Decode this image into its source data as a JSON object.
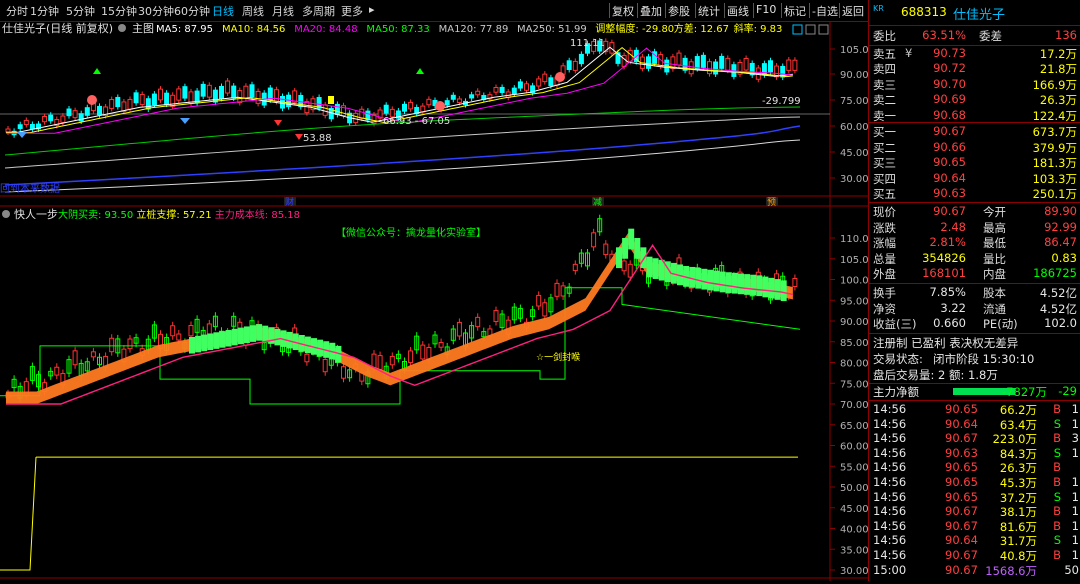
{
  "toolbar": {
    "periods": [
      "分时",
      "1分钟",
      "5分钟",
      "15分钟",
      "30分钟",
      "60分钟",
      "日线",
      "周线",
      "月线",
      "多周期",
      "更多"
    ],
    "active": "日线",
    "right_buttons": [
      "复权",
      "叠加",
      "参股",
      "统计",
      "画线",
      "F10",
      "标记",
      "-自选",
      "返回"
    ]
  },
  "main_chart": {
    "stock_title": "仕佳光子(日线 前复权)",
    "title_tag": "主图",
    "ma_items": [
      {
        "label": "MA5: 87.95",
        "color": "#ffffff"
      },
      {
        "label": "MA10: 84.56",
        "color": "#ffff00"
      },
      {
        "label": "MA20: 84.48",
        "color": "#ff00ff"
      },
      {
        "label": "MA50: 87.33",
        "color": "#00ff00"
      },
      {
        "label": "MA120: 77.89",
        "color": "#c8c8c8"
      },
      {
        "label": "MA250: 51.99",
        "color": "#c8c8c8"
      },
      {
        "label": "调整幅度: -29.80",
        "color": "#ffff00"
      },
      {
        "label": "方差: 12.67",
        "color": "#ffff00"
      },
      {
        "label": "斜率: 9.83",
        "color": "#ffff00"
      }
    ],
    "y_ticks": [
      "105.0",
      "90.00",
      "75.00",
      "60.00",
      "45.00",
      "30.00"
    ],
    "annotations": {
      "high": "111.11",
      "low": "53.88",
      "range": "66.93 - 67.05",
      "pct": "-29.799",
      "bottom_left": "回到本来数据"
    },
    "events": [
      "财",
      "减",
      "预"
    ]
  },
  "sub_chart": {
    "title": "快人一步",
    "legend": [
      {
        "label": "大阴买卖: 93.50",
        "color": "#00ff00"
      },
      {
        "label": "立桩支撑: 57.21",
        "color": "#ffff00"
      },
      {
        "label": "主力成本线: 85.18",
        "color": "#ff2080"
      }
    ],
    "banner": "【微信公众号：擒龙量化实验室】",
    "signal": "☆一剑封喉",
    "y_ticks": [
      "110.0",
      "105.0",
      "100.0",
      "95.00",
      "90.00",
      "85.00",
      "80.00",
      "75.00",
      "70.00",
      "65.00",
      "60.00",
      "55.00",
      "50.00",
      "45.00",
      "40.00",
      "35.00",
      "30.00"
    ]
  },
  "quote": {
    "market": "KR",
    "code": "688313",
    "name": "仕佳光子",
    "weibi": {
      "label": "委比",
      "value": "63.51%",
      "label2": "委差",
      "value2": "136"
    },
    "asks": [
      {
        "label": "卖五",
        "mark": "¥",
        "price": "90.73",
        "vol": "17.2万"
      },
      {
        "label": "卖四",
        "mark": "",
        "price": "90.72",
        "vol": "21.8万"
      },
      {
        "label": "卖三",
        "mark": "",
        "price": "90.70",
        "vol": "166.9万"
      },
      {
        "label": "卖二",
        "mark": "",
        "price": "90.69",
        "vol": "26.3万"
      },
      {
        "label": "卖一",
        "mark": "",
        "price": "90.68",
        "vol": "122.4万"
      }
    ],
    "bids": [
      {
        "label": "买一",
        "price": "90.67",
        "vol": "673.7万"
      },
      {
        "label": "买二",
        "price": "90.66",
        "vol": "379.9万"
      },
      {
        "label": "买三",
        "price": "90.65",
        "vol": "181.3万"
      },
      {
        "label": "买四",
        "price": "90.64",
        "vol": "103.3万"
      },
      {
        "label": "买五",
        "price": "90.63",
        "vol": "250.1万"
      }
    ],
    "stats": [
      {
        "l1": "现价",
        "v1": "90.67",
        "c1": "red",
        "l2": "今开",
        "v2": "89.90",
        "c2": "red"
      },
      {
        "l1": "涨跌",
        "v1": "2.48",
        "c1": "red",
        "l2": "最高",
        "v2": "92.99",
        "c2": "red"
      },
      {
        "l1": "涨幅",
        "v1": "2.81%",
        "c1": "red",
        "l2": "最低",
        "v2": "86.47",
        "c2": "red"
      },
      {
        "l1": "总量",
        "v1": "354826",
        "c1": "yellow",
        "l2": "量比",
        "v2": "0.83",
        "c2": "yellow"
      },
      {
        "l1": "外盘",
        "v1": "168101",
        "c1": "red",
        "l2": "内盘",
        "v2": "186725",
        "c2": "green"
      }
    ],
    "stats2": [
      {
        "l1": "换手",
        "v1": "7.85%",
        "l2": "股本",
        "v2": "4.52亿"
      },
      {
        "l1": "净资",
        "v1": "3.22",
        "l2": "流通",
        "v2": "4.52亿"
      },
      {
        "l1": "收益(三)",
        "v1": "0.660",
        "l2": "PE(动)",
        "v2": "102.0"
      }
    ],
    "info1": "注册制 已盈利 表决权无差异",
    "info2_label": "交易状态:",
    "info2_value": "闭市阶段 15:30:10",
    "info3": "盘后交易量: 2  额: 1.8万",
    "main_flow_label": "主力净额",
    "main_flow_value": "-7827万",
    "main_flow_tail": "-29",
    "ticks": [
      {
        "t": "14:56",
        "p": "90.65",
        "v": "66.2万",
        "s": "B",
        "n": "1"
      },
      {
        "t": "14:56",
        "p": "90.64",
        "v": "63.4万",
        "s": "S",
        "n": "1"
      },
      {
        "t": "14:56",
        "p": "90.67",
        "v": "223.0万",
        "s": "B",
        "n": "3"
      },
      {
        "t": "14:56",
        "p": "90.63",
        "v": "84.3万",
        "s": "S",
        "n": "1"
      },
      {
        "t": "14:56",
        "p": "90.65",
        "v": "26.3万",
        "s": "B",
        "n": ""
      },
      {
        "t": "14:56",
        "p": "90.65",
        "v": "45.3万",
        "s": "B",
        "n": "1"
      },
      {
        "t": "14:56",
        "p": "90.65",
        "v": "37.2万",
        "s": "S",
        "n": "1"
      },
      {
        "t": "14:56",
        "p": "90.67",
        "v": "38.1万",
        "s": "B",
        "n": "1"
      },
      {
        "t": "14:56",
        "p": "90.67",
        "v": "81.6万",
        "s": "B",
        "n": "1"
      },
      {
        "t": "14:56",
        "p": "90.64",
        "v": "31.7万",
        "s": "S",
        "n": "1"
      },
      {
        "t": "14:56",
        "p": "90.67",
        "v": "40.8万",
        "s": "B",
        "n": "1"
      },
      {
        "t": "15:00",
        "p": "90.67",
        "v": "1568.6万",
        "s": "",
        "n": "50"
      }
    ]
  },
  "colors": {
    "up": "#ff3333",
    "down": "#00ffff",
    "border": "#8b0000",
    "accent": "#00bfff"
  }
}
